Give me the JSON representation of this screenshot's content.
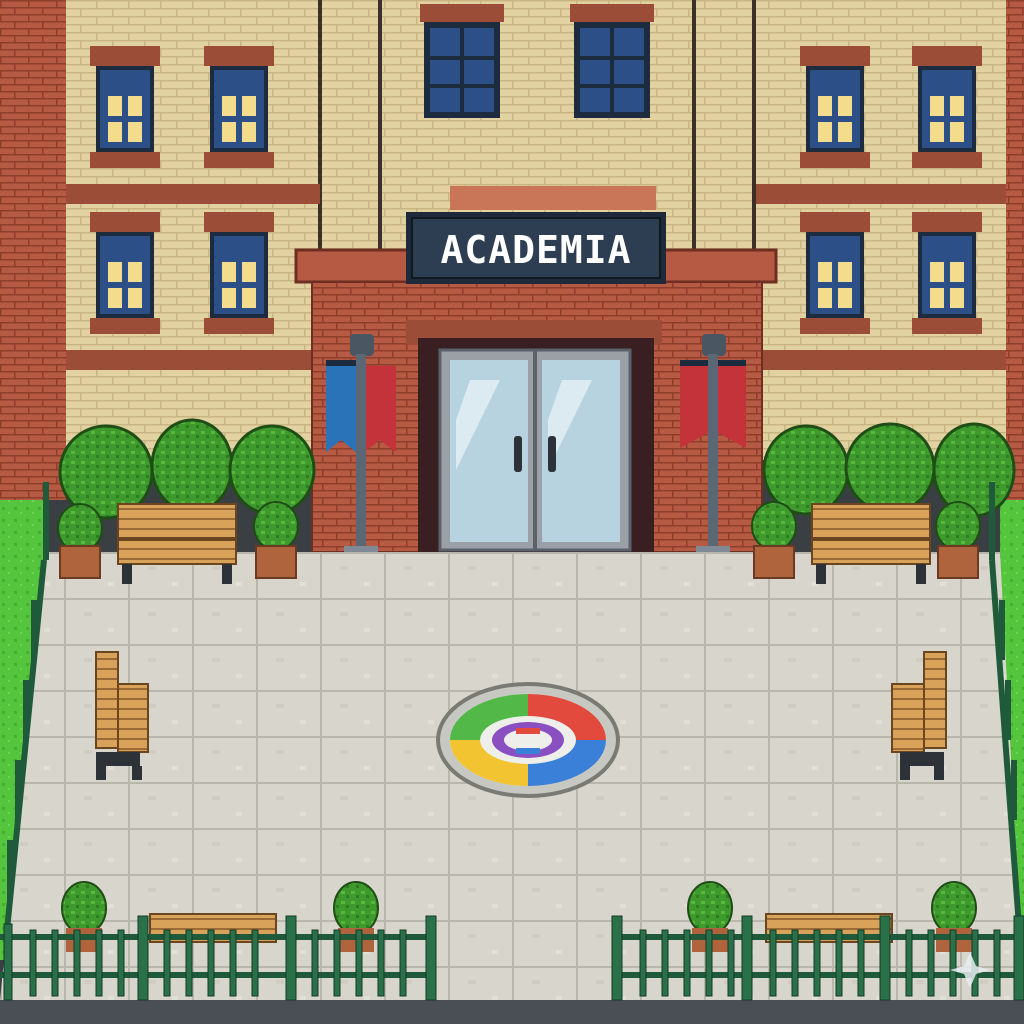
{
  "sign": {
    "text": "ACADEMIA"
  },
  "colors": {
    "brick": "#b65a43",
    "tan_brick": "#e3d2a1",
    "window_lit": "#f3dd8c",
    "window_dark": "#2b4f86",
    "plaza": "#d8d6cc",
    "grass": "#55c53e",
    "fence": "#1f5a3a",
    "bench_wood": "#d9a25a",
    "banner_blue": "#2a73b8",
    "banner_red": "#c4323a",
    "emblem_green": "#52b948",
    "emblem_red": "#e14a3c",
    "emblem_yellow": "#f2c431",
    "emblem_blue": "#3a7fd8",
    "emblem_purple": "#8a4fc1"
  },
  "icons": [
    "building",
    "window",
    "door",
    "lamp-post",
    "banner",
    "bench",
    "shrub",
    "potted-plant",
    "fence",
    "emblem",
    "sparkle"
  ]
}
